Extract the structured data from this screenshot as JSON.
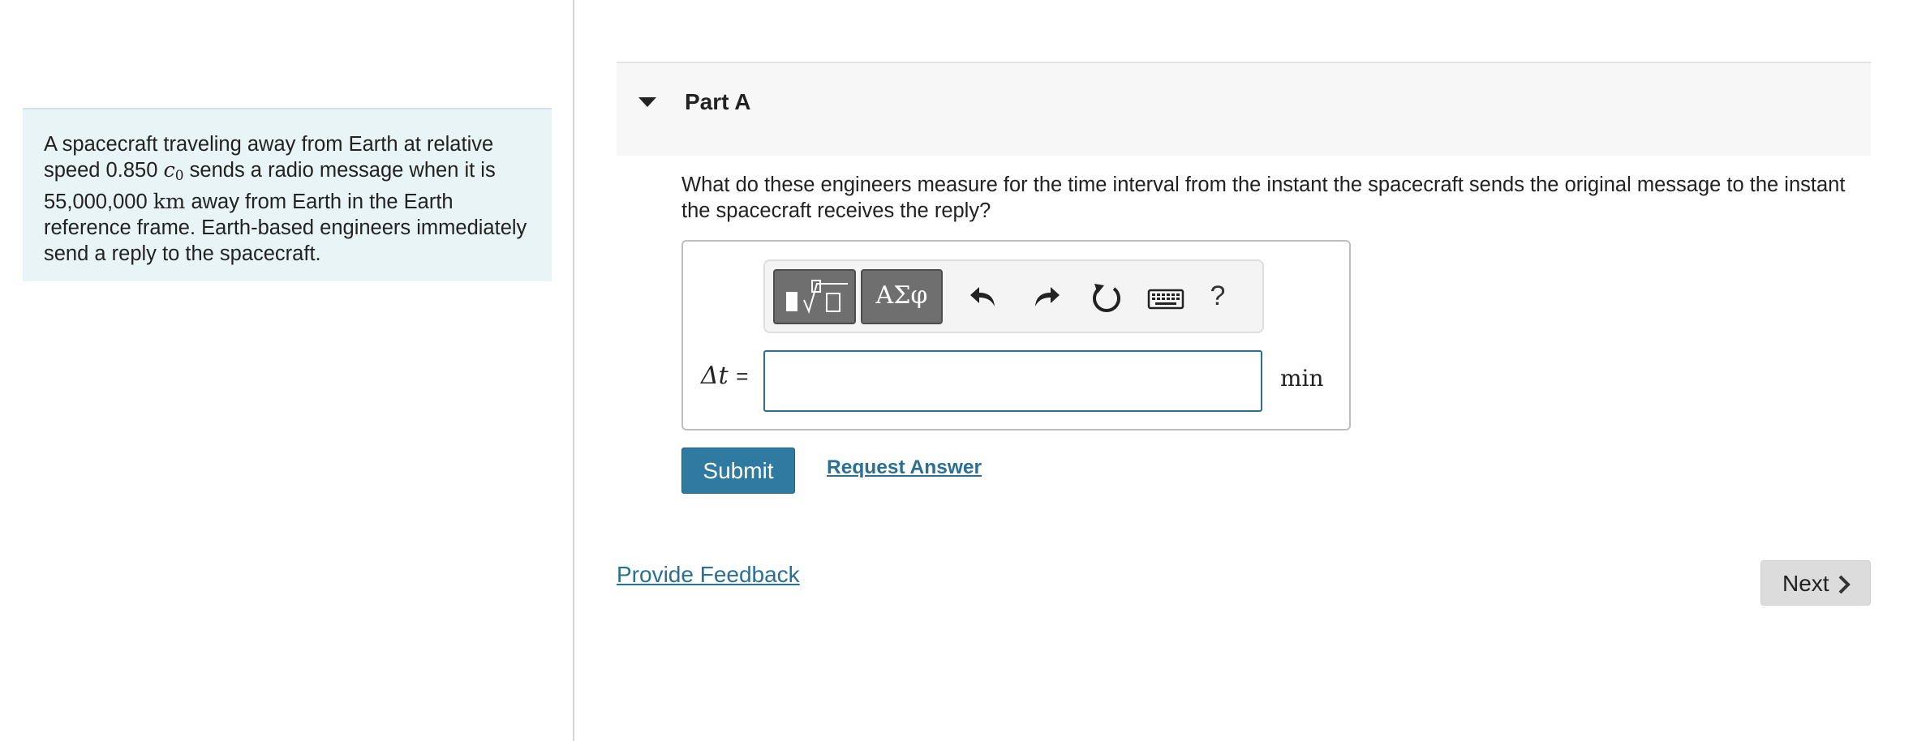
{
  "problem": {
    "text_1": "A spacecraft traveling away from Earth at relative speed 0.850 ",
    "c_symbol": "c",
    "c_subscript": "0",
    "text_2": " sends a radio message when it is 55,000,000 ",
    "unit_km": "km",
    "text_3": " away from Earth in the Earth reference frame. Earth-based engineers immediately send a reply to the spacecraft."
  },
  "part": {
    "title": "Part A",
    "question": "What do these engineers measure for the time interval from the instant the spacecraft sends the original message to the instant the spacecraft receives the reply?"
  },
  "toolbar": {
    "greek_label": "ΑΣφ",
    "help_label": "?",
    "icons": [
      "templates-icon",
      "greek-letters-icon",
      "undo-icon",
      "redo-icon",
      "reset-icon",
      "keyboard-icon",
      "help-icon"
    ]
  },
  "answer": {
    "variable": "Δt",
    "equals": "=",
    "value": "",
    "placeholder": "",
    "unit": "min"
  },
  "actions": {
    "submit_label": "Submit",
    "request_answer_label": "Request Answer",
    "feedback_label": "Provide Feedback",
    "next_label": "Next"
  },
  "colors": {
    "accent": "#2f7aa0",
    "link": "#2a6f94",
    "problem_bg": "#e8f4f5"
  }
}
